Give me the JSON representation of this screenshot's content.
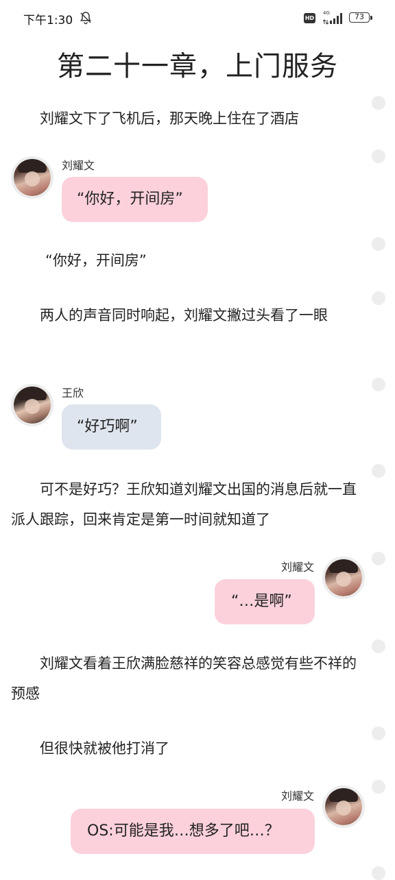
{
  "status_bar": {
    "time": "下午1:30",
    "hd": "HD",
    "network": "4G",
    "battery": "73"
  },
  "chapter": {
    "title": "第二十一章，上门服务"
  },
  "story": [
    {
      "type": "para",
      "text": "刘耀文下了飞机后，那天晚上住在了酒店"
    },
    {
      "type": "chat",
      "side": "left",
      "speaker": "刘耀文",
      "text": "“你好，开间房”",
      "bubble_color": "#fcd1dc"
    },
    {
      "type": "para",
      "text": "“你好，开间房”"
    },
    {
      "type": "para",
      "text": "两人的声音同时响起，刘耀文撇过头看了一眼"
    },
    {
      "type": "chat",
      "side": "left",
      "speaker": "王欣",
      "text": "“好巧啊”",
      "bubble_color": "#dfe5ee"
    },
    {
      "type": "para",
      "text": "可不是好巧？王欣知道刘耀文出国的消息后就一直派人跟踪，回来肯定是第一时间就知道了"
    },
    {
      "type": "chat",
      "side": "right",
      "speaker": "刘耀文",
      "text": "“…是啊”",
      "bubble_color": "#fcd1dc"
    },
    {
      "type": "para",
      "text": "刘耀文看着王欣满脸慈祥的笑容总感觉有些不祥的预感"
    },
    {
      "type": "para",
      "text": "但很快就被他打消了"
    },
    {
      "type": "chat",
      "side": "right",
      "speaker": "刘耀文",
      "text": "OS:可能是我…想多了吧…？",
      "bubble_color": "#fcd1dc"
    }
  ]
}
